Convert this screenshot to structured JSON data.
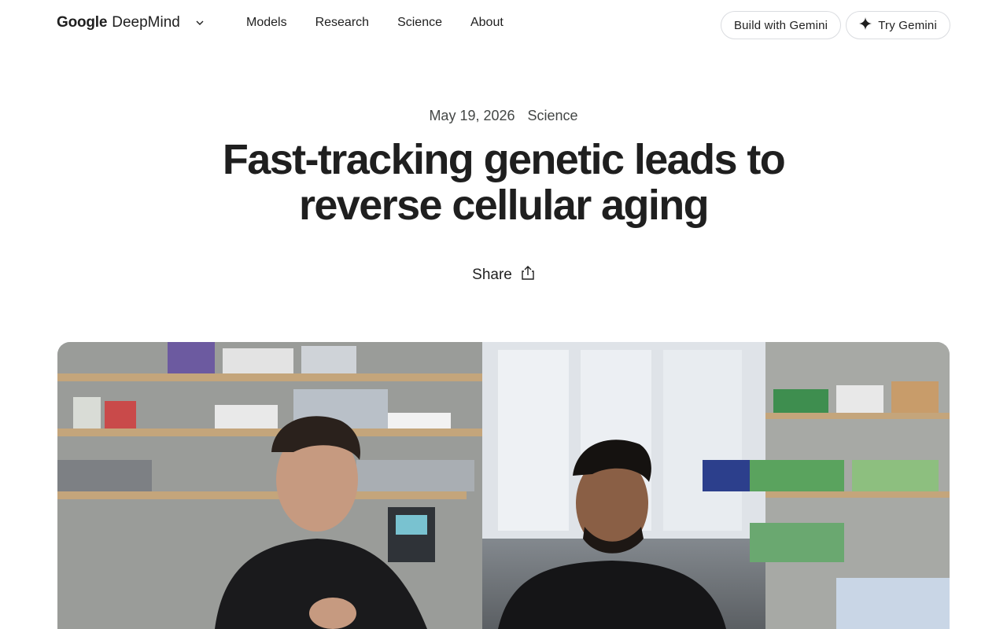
{
  "header": {
    "brand_google": "Google",
    "brand_name": "DeepMind",
    "nav": [
      "Models",
      "Research",
      "Science",
      "About"
    ],
    "build_label": "Build with Gemini",
    "try_label": "Try Gemini"
  },
  "article": {
    "date": "May 19, 2026",
    "category": "Science",
    "title_line1": "Fast-tracking genetic leads to",
    "title_line2": "reverse cellular aging",
    "share_label": "Share"
  },
  "icons": {
    "brand_menu": "chevron-down-icon",
    "try": "sparkle-icon",
    "share": "share-icon"
  },
  "colors": {
    "text": "#1f1f1f",
    "muted": "#444746",
    "pill_border": "#dadce0"
  }
}
